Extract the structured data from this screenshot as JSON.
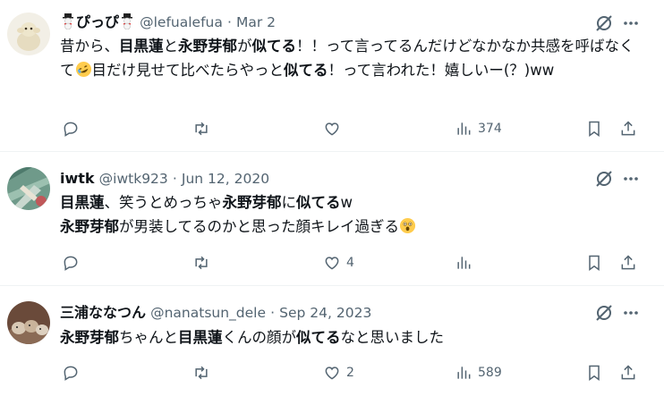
{
  "tweets": [
    {
      "name": "ぴっぴ",
      "handle": "@lefualefua",
      "sep": "·",
      "date": "Mar 2",
      "body": [
        {
          "t": "昔から、",
          "b": false
        },
        {
          "t": "目黒蓮",
          "b": true
        },
        {
          "t": "と",
          "b": false
        },
        {
          "t": "永野芽郁",
          "b": true
        },
        {
          "t": "が",
          "b": false
        },
        {
          "t": "似てる",
          "b": true
        },
        {
          "t": "！！って言ってるんだけどなかなか共感を呼ばなくて",
          "b": false
        },
        {
          "emoji": "rofl-face-icon"
        },
        {
          "t": "目だけ見せて比べたらやっと",
          "b": false
        },
        {
          "t": "似てる",
          "b": true
        },
        {
          "t": "！って言われた！嬉しいー(？)ww",
          "b": false
        }
      ],
      "stats": {
        "reply": "",
        "retweet": "",
        "like": "",
        "views": "374"
      }
    },
    {
      "name": "iwtk",
      "handle": "@iwtk923",
      "sep": "·",
      "date": "Jun 12, 2020",
      "body": [
        {
          "t": "目黒蓮",
          "b": true
        },
        {
          "t": "、笑うとめっちゃ",
          "b": false
        },
        {
          "t": "永野芽郁",
          "b": true
        },
        {
          "t": "に",
          "b": false
        },
        {
          "t": "似てる",
          "b": true
        },
        {
          "t": "w",
          "b": false
        },
        {
          "br": true
        },
        {
          "t": "永野芽郁",
          "b": true
        },
        {
          "t": "が男装してるのかと思った顔キレイ過ぎる",
          "b": false
        },
        {
          "emoji": "astonished-face-icon"
        }
      ],
      "stats": {
        "reply": "",
        "retweet": "",
        "like": "4",
        "views": ""
      }
    },
    {
      "name": "三浦ななつん",
      "handle": "@nanatsun_dele",
      "sep": "·",
      "date": "Sep 24, 2023",
      "body": [
        {
          "t": "永野芽郁",
          "b": true
        },
        {
          "t": "ちゃんと",
          "b": false
        },
        {
          "t": "目黒蓮",
          "b": true
        },
        {
          "t": "くんの顔が",
          "b": false
        },
        {
          "t": "似てる",
          "b": true
        },
        {
          "t": "なと思いました",
          "b": false
        }
      ],
      "stats": {
        "reply": "",
        "retweet": "",
        "like": "2",
        "views": "589"
      }
    }
  ],
  "colors": {
    "text": "#0f1419",
    "secondary": "#536471",
    "divider": "#eff3f4"
  },
  "icons": [
    "snowman-icon",
    "grok-icon",
    "more-icon",
    "reply-icon",
    "retweet-icon",
    "like-icon",
    "views-icon",
    "bookmark-icon",
    "share-icon"
  ]
}
